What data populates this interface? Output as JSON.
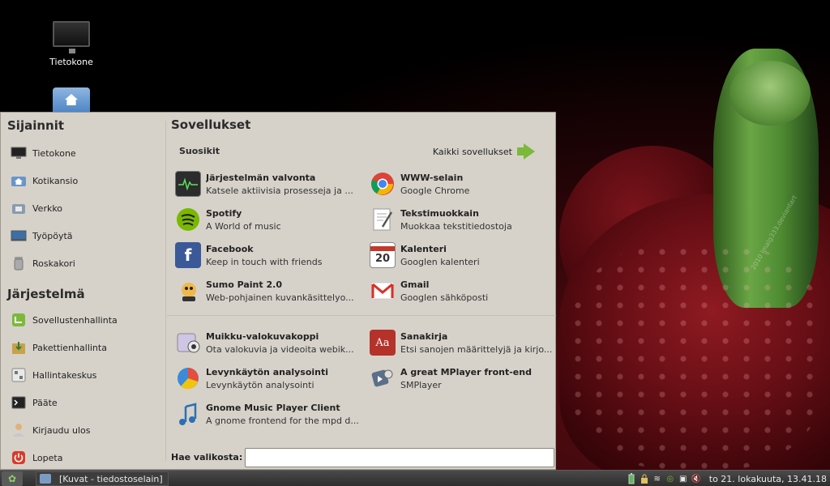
{
  "desktop": {
    "icons": [
      {
        "label": "Tietokone",
        "icon": "computer-icon"
      },
      {
        "label": "",
        "icon": "home-folder-icon"
      }
    ],
    "watermark": "2010 lmalg333.deviantart"
  },
  "menu": {
    "places": {
      "title": "Sijainnit",
      "items": [
        {
          "label": "Tietokone",
          "icon": "computer-icon"
        },
        {
          "label": "Kotikansio",
          "icon": "home-folder-icon"
        },
        {
          "label": "Verkko",
          "icon": "network-icon"
        },
        {
          "label": "Työpöytä",
          "icon": "desktop-icon"
        },
        {
          "label": "Roskakori",
          "icon": "trash-icon"
        }
      ]
    },
    "system": {
      "title": "Järjestelmä",
      "items": [
        {
          "label": "Sovellustenhallinta",
          "icon": "software-manager-icon"
        },
        {
          "label": "Pakettienhallinta",
          "icon": "package-manager-icon"
        },
        {
          "label": "Hallintakeskus",
          "icon": "control-center-icon"
        },
        {
          "label": "Pääte",
          "icon": "terminal-icon"
        },
        {
          "label": "Kirjaudu ulos",
          "icon": "logout-icon"
        },
        {
          "label": "Lopeta",
          "icon": "power-icon"
        }
      ]
    },
    "apps": {
      "title": "Sovellukset",
      "favorites_label": "Suosikit",
      "all_apps_label": "Kaikki sovellukset",
      "favorites": [
        {
          "name": "Järjestelmän valvonta",
          "desc": "Katsele aktiivisia prosesseja ja ...",
          "icon": "system-monitor-icon"
        },
        {
          "name": "WWW-selain",
          "desc": "Google Chrome",
          "icon": "chrome-icon"
        },
        {
          "name": "Spotify",
          "desc": "A World of music",
          "icon": "spotify-icon"
        },
        {
          "name": "Tekstimuokkain",
          "desc": "Muokkaa tekstitiedostoja",
          "icon": "text-editor-icon"
        },
        {
          "name": "Facebook",
          "desc": "Keep in touch with friends",
          "icon": "facebook-icon"
        },
        {
          "name": "Kalenteri",
          "desc": "Googlen kalenteri",
          "icon": "calendar-icon",
          "badge": "20"
        },
        {
          "name": "Sumo Paint 2.0",
          "desc": "Web-pohjainen kuvankäsittelyo...",
          "icon": "sumo-paint-icon"
        },
        {
          "name": "Gmail",
          "desc": "Googlen sähköposti",
          "icon": "gmail-icon"
        }
      ],
      "more": [
        {
          "name": "Muikku-valokuvakoppi",
          "desc": "Ota valokuvia ja videoita webik...",
          "icon": "webcam-icon"
        },
        {
          "name": "Sanakirja",
          "desc": "Etsi sanojen määrittelyjä ja kirjo...",
          "icon": "dictionary-icon",
          "badge": "Aa"
        },
        {
          "name": "Levynkäytön analysointi",
          "desc": "Levynkäytön analysointi",
          "icon": "disk-usage-icon"
        },
        {
          "name": "A great MPlayer front-end",
          "desc": "SMPlayer",
          "icon": "smplayer-icon"
        },
        {
          "name": "Gnome Music Player Client",
          "desc": "A gnome frontend for the mpd d...",
          "icon": "music-player-icon"
        }
      ]
    },
    "search": {
      "label": "Hae valikosta:",
      "value": "",
      "placeholder": ""
    }
  },
  "taskbar": {
    "task_label": "[Kuvat - tiedostoselain]",
    "clock": "to 21. lokakuuta, 13.41.18"
  }
}
